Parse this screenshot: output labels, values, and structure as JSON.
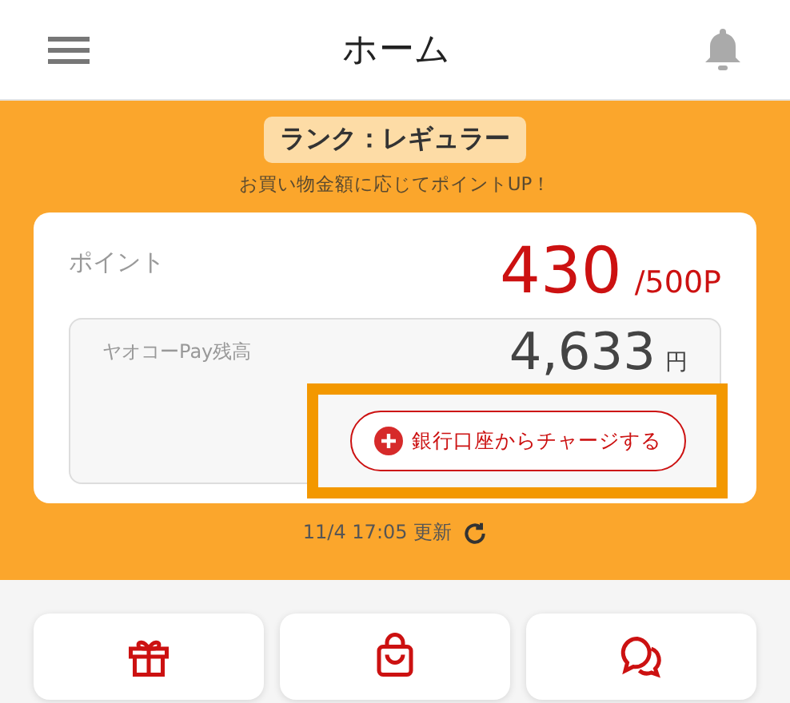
{
  "header": {
    "title": "ホーム"
  },
  "rank": {
    "badge": "ランク：レギュラー",
    "note": "お買い物金額に応じてポイントUP！"
  },
  "points": {
    "label": "ポイント",
    "value": "430",
    "target": "/500P"
  },
  "balance": {
    "label": "ヤオコーPay残高",
    "value": "4,633",
    "unit": "円",
    "charge_button": "銀行口座からチャージする",
    "highlighted": true
  },
  "updated": {
    "text": "11/4 17:05 更新"
  },
  "shortcuts": [
    {
      "kind": "gift"
    },
    {
      "kind": "bag"
    },
    {
      "kind": "chat"
    }
  ]
}
